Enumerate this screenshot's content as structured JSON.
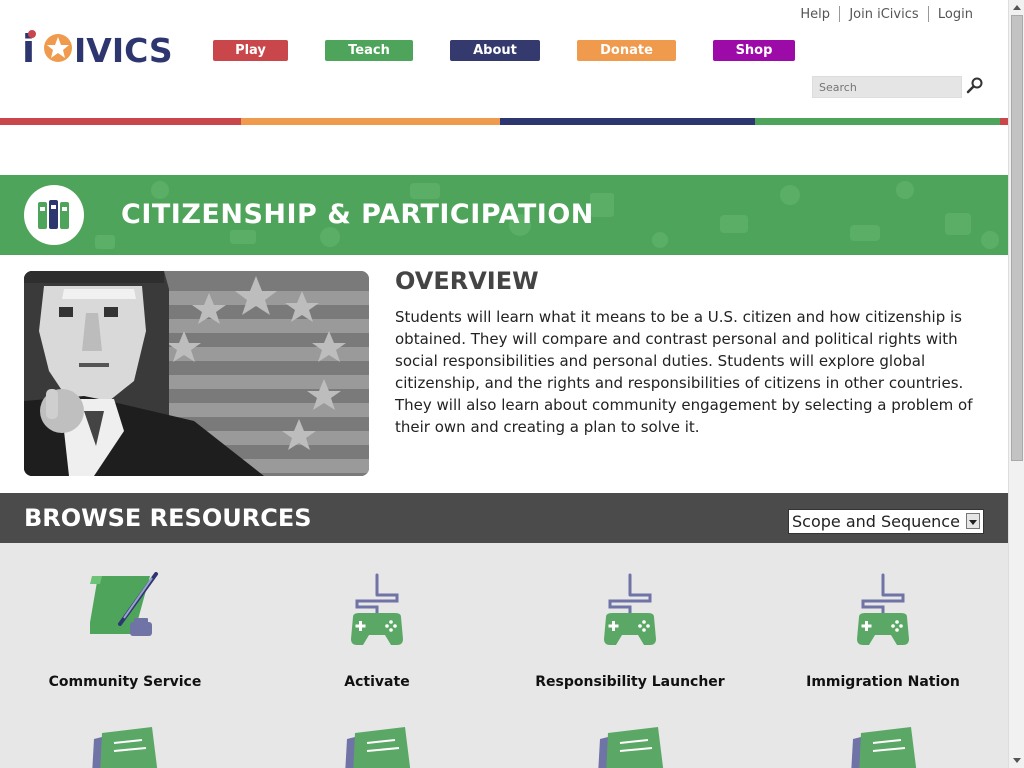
{
  "header": {
    "logo_alt": "iCivics",
    "top_links": [
      "Help",
      "Join iCivics",
      "Login"
    ],
    "nav": [
      {
        "label": "Play",
        "color": "#c9474a"
      },
      {
        "label": "Teach",
        "color": "#4ea45a"
      },
      {
        "label": "About",
        "color": "#343a6e"
      },
      {
        "label": "Donate",
        "color": "#ef9a4c"
      },
      {
        "label": "Shop",
        "color": "#9c0aa8"
      }
    ],
    "search_placeholder": "Search"
  },
  "banner": {
    "title": "CITIZENSHIP & PARTICIPATION"
  },
  "overview": {
    "title": "OVERVIEW",
    "text": "Students will learn what it means to be a U.S. citizen and how citizenship is obtained. They will compare and contrast personal and political rights with social responsibilities and personal duties. Students will explore global citizenship, and the rights and responsibilities of citizens in other countries. They will also learn about community engagement by selecting a problem of their own and creating a plan to solve it."
  },
  "browse": {
    "title": "BROWSE RESOURCES",
    "select_value": "Scope and Sequence",
    "resources": [
      {
        "label": "Community Service",
        "icon": "quill-scroll-icon"
      },
      {
        "label": "Activate",
        "icon": "game-controller-icon"
      },
      {
        "label": "Responsibility Launcher",
        "icon": "game-controller-icon"
      },
      {
        "label": "Immigration Nation",
        "icon": "game-controller-icon"
      }
    ]
  },
  "colors": {
    "red": "#c9474a",
    "orange": "#ef9a4c",
    "navy": "#2e3670",
    "green": "#4ea45a",
    "dark_gray": "#4b4b4b"
  }
}
